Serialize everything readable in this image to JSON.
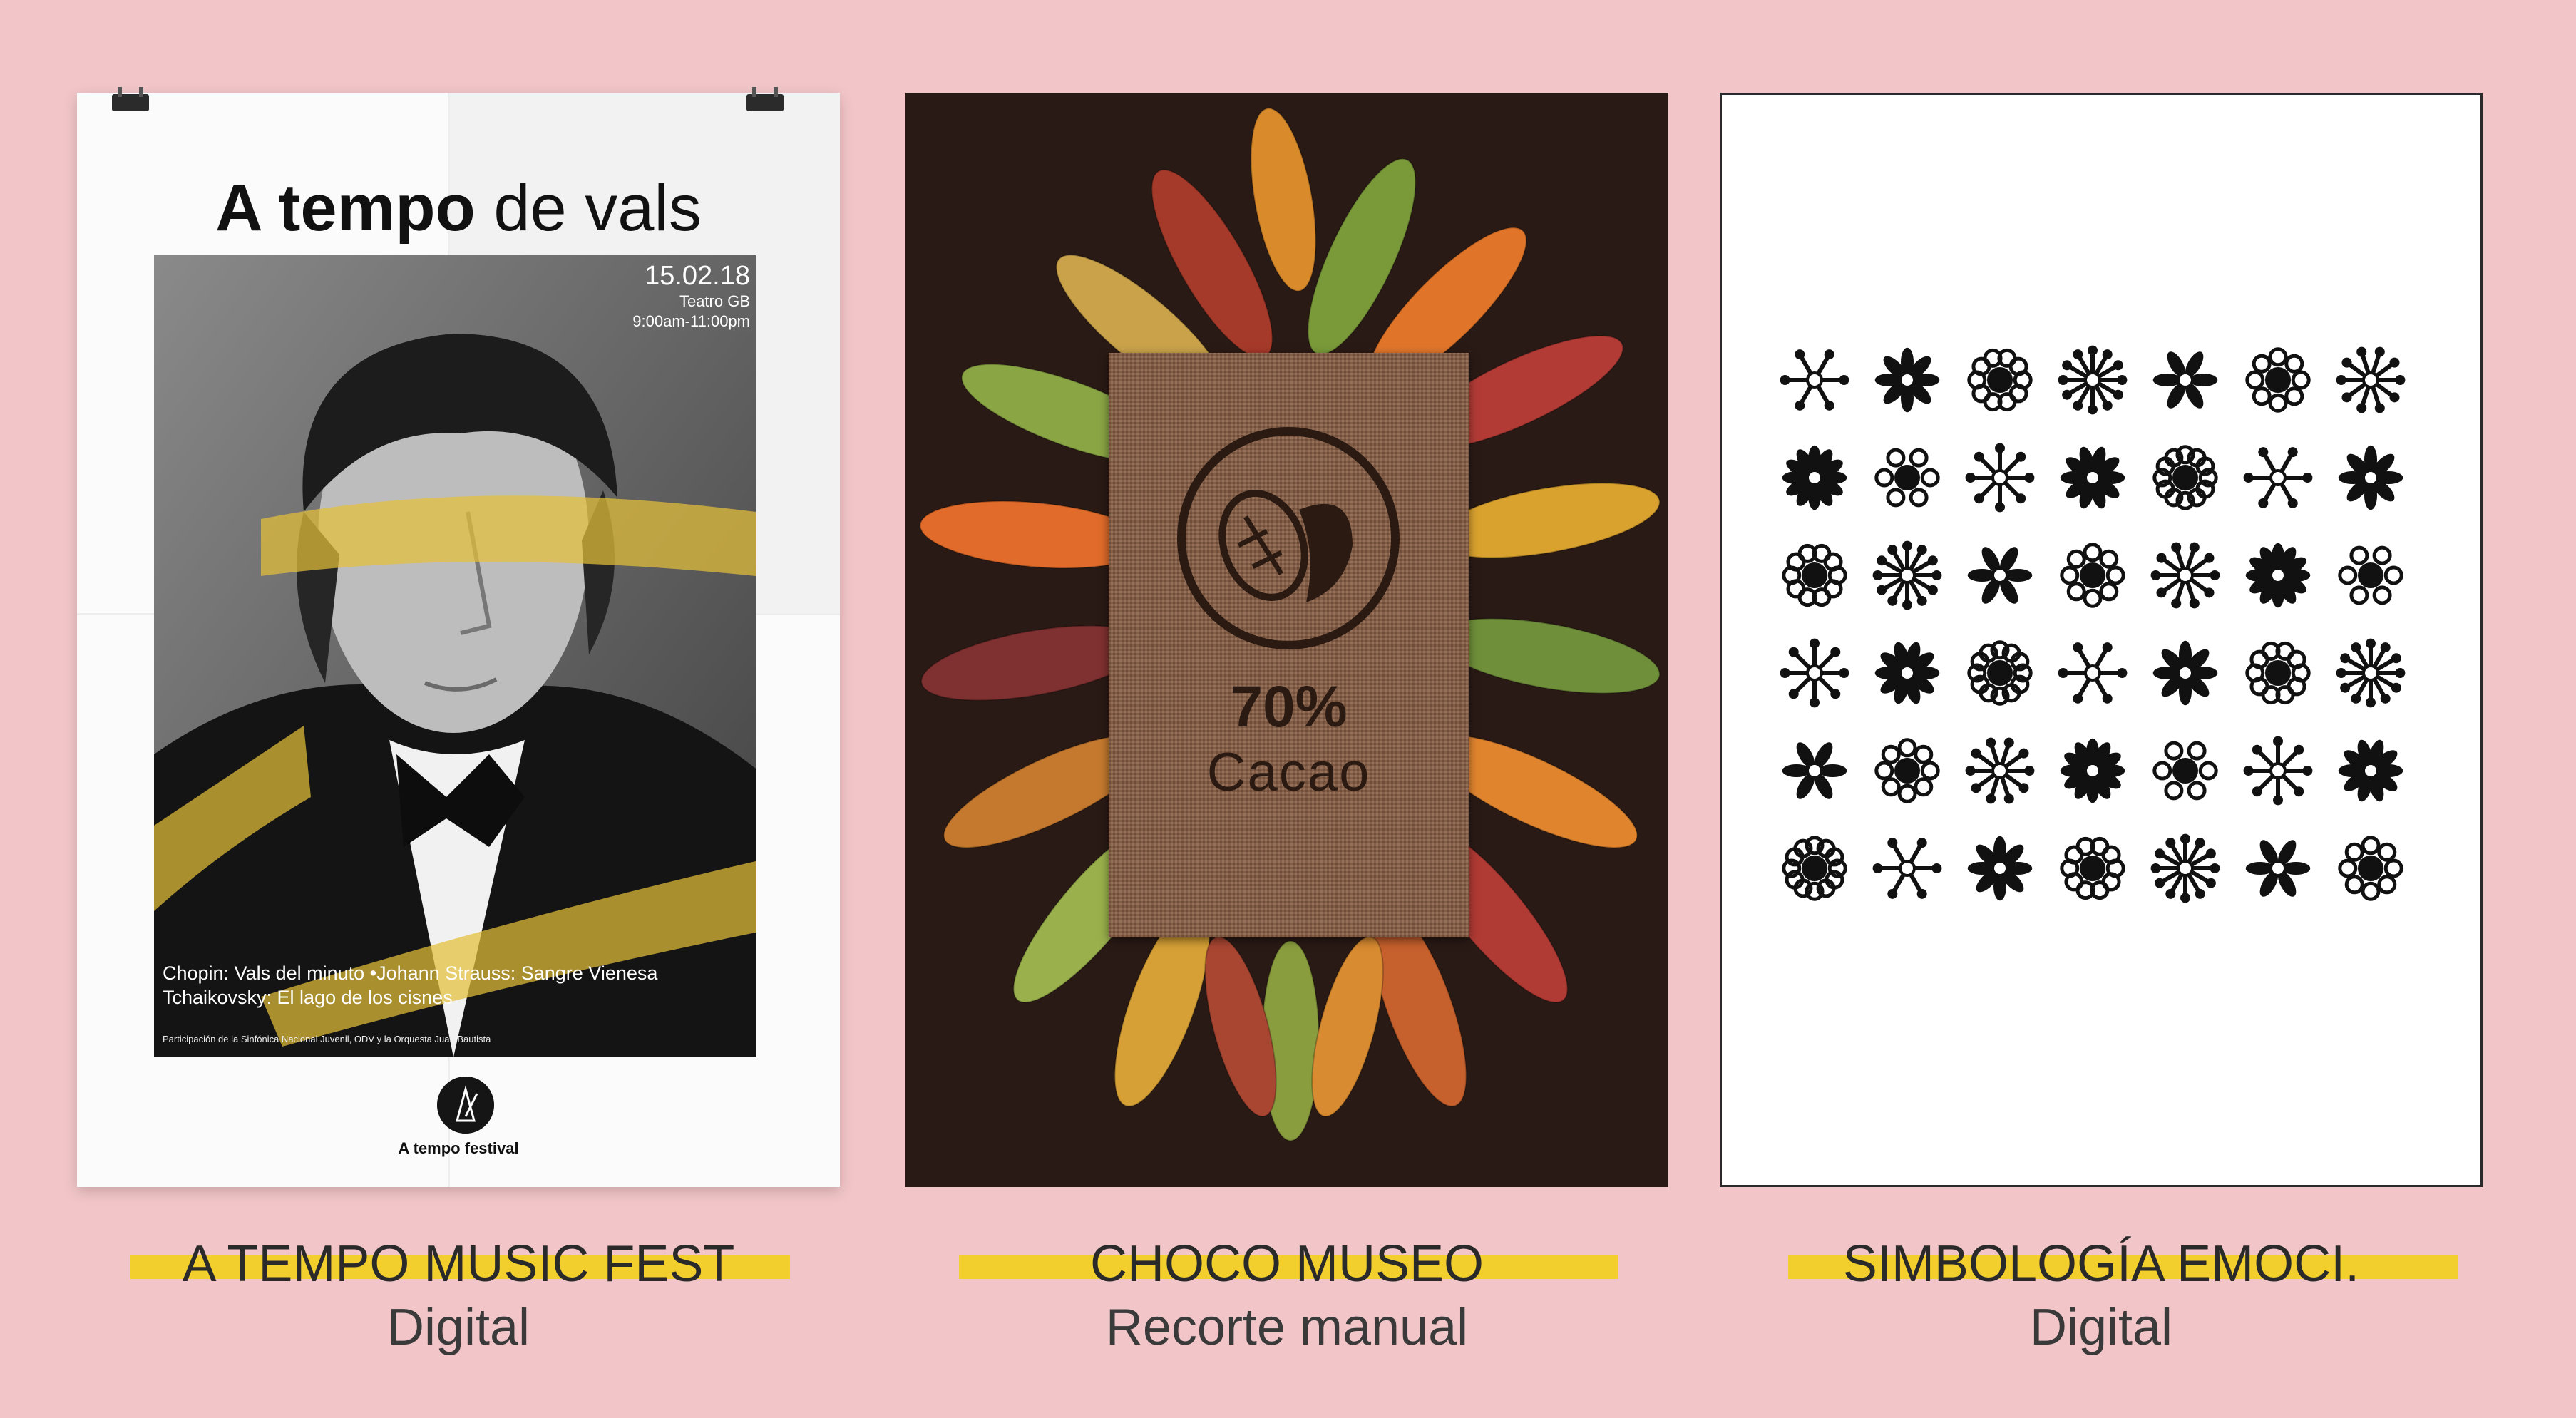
{
  "poster": {
    "title_bold": "A tempo",
    "title_rest": " de vals",
    "date": "15.02.18",
    "venue": "Teatro GB",
    "hours": "9:00am-11:00pm",
    "program_line1": "Chopin: Vals del minuto •Johann Strauss: Sangre Vienesa",
    "program_line2": "Tchaikovsky: El lago de los cisnes",
    "small_print": "Participación de la Sinfónica Nacional Juvenil, ODV y la Orquesta Juan Bautista",
    "logo_label": "A tempo festival"
  },
  "cacao": {
    "percent": "70%",
    "word": "Cacao"
  },
  "captions": [
    {
      "title": "A TEMPO MUSIC FEST",
      "subtitle": "Digital"
    },
    {
      "title": "CHOCO MUSEO",
      "subtitle": "Recorte manual"
    },
    {
      "title": "SIMBOLOGÍA EMOCI.",
      "subtitle": "Digital"
    }
  ],
  "colors": {
    "background": "#f2c6c8",
    "accent_yellow": "#f3cf2e",
    "text_dark": "#2a2a2a"
  },
  "icons": [
    "binder-clip-icon",
    "metronome-icon",
    "cacao-pod-icon",
    "mandala-symbol-icon"
  ]
}
